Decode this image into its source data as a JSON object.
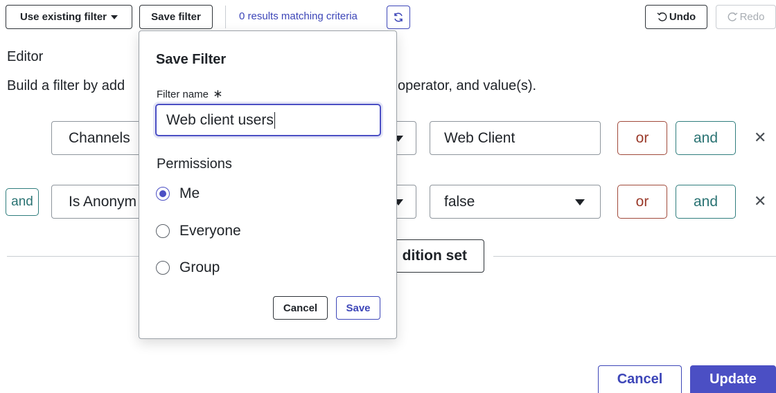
{
  "toolbar": {
    "use_existing_filter_label": "Use existing filter",
    "save_filter_label": "Save filter",
    "results_text": "0 results matching criteria",
    "undo_label": "Undo",
    "redo_label": "Redo"
  },
  "editor": {
    "heading": "Editor",
    "description_left": "Build a filter by add",
    "description_right": "operator, and value(s)."
  },
  "conditions": [
    {
      "field_label": "Channels",
      "value": "Web Client",
      "or_label": "or",
      "and_label": "and"
    },
    {
      "prefix_label": "and",
      "field_label": "Is Anonym",
      "value": "false",
      "or_label": "or",
      "and_label": "and"
    }
  ],
  "add_condition_set_label": "dition set",
  "save_filter_popover": {
    "title": "Save Filter",
    "name_label": "Filter name",
    "required_mark": "∗",
    "name_value": "Web client users",
    "permissions_label": "Permissions",
    "options": [
      {
        "label": "Me",
        "selected": true
      },
      {
        "label": "Everyone",
        "selected": false
      },
      {
        "label": "Group",
        "selected": false
      }
    ],
    "cancel_label": "Cancel",
    "save_label": "Save"
  },
  "footer": {
    "cancel_label": "Cancel",
    "update_label": "Update"
  },
  "icons": {
    "refresh": "refresh-icon",
    "undo": "undo-icon",
    "redo": "redo-icon",
    "remove": "close-icon"
  },
  "colors": {
    "accent": "#4b4fc4",
    "or_color": "#9a3a2a",
    "and_color": "#2a7373",
    "link_color": "#3d46b8"
  }
}
